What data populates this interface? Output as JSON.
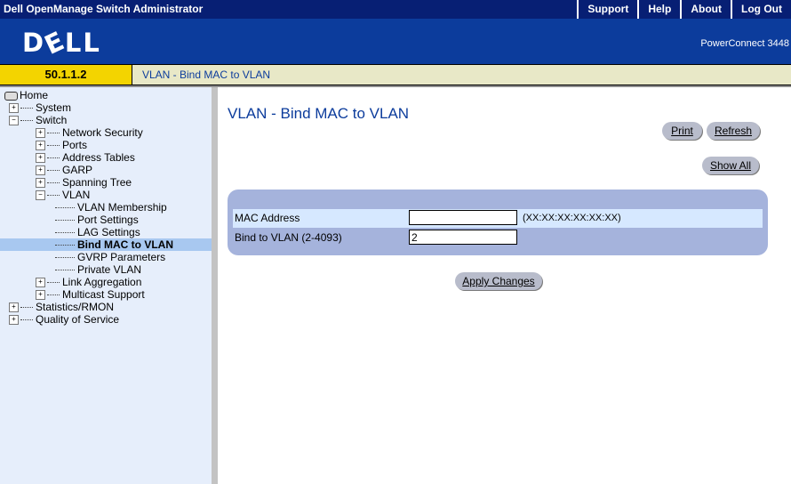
{
  "header": {
    "app_title": "Dell OpenManage Switch Administrator",
    "nav": [
      "Support",
      "Help",
      "About",
      "Log Out"
    ],
    "logo_text": "DELL",
    "product": "PowerConnect 3448"
  },
  "address": {
    "ip": "50.1.1.2",
    "breadcrumb": "VLAN - Bind MAC to VLAN"
  },
  "sidebar": {
    "items": [
      {
        "label": "Home",
        "icon": "home-icon"
      },
      {
        "label": "System",
        "toggle": "+"
      },
      {
        "label": "Switch",
        "toggle": "-"
      },
      {
        "label": "Network Security",
        "toggle": "+"
      },
      {
        "label": "Ports",
        "toggle": "+"
      },
      {
        "label": "Address Tables",
        "toggle": "+"
      },
      {
        "label": "GARP",
        "toggle": "+"
      },
      {
        "label": "Spanning Tree",
        "toggle": "+"
      },
      {
        "label": "VLAN",
        "toggle": "-"
      },
      {
        "label": "VLAN Membership"
      },
      {
        "label": "Port Settings"
      },
      {
        "label": "LAG Settings"
      },
      {
        "label": "Bind MAC to VLAN",
        "selected": true
      },
      {
        "label": "GVRP Parameters"
      },
      {
        "label": "Private VLAN"
      },
      {
        "label": "Link Aggregation",
        "toggle": "+"
      },
      {
        "label": "Multicast Support",
        "toggle": "+"
      },
      {
        "label": "Statistics/RMON",
        "toggle": "+"
      },
      {
        "label": "Quality of Service",
        "toggle": "+"
      }
    ]
  },
  "main": {
    "title": "VLAN - Bind MAC to VLAN",
    "print_label": "Print",
    "refresh_label": "Refresh",
    "show_all_label": "Show All",
    "form": {
      "mac_label": "MAC Address",
      "mac_value": "",
      "mac_hint": "(XX:XX:XX:XX:XX:XX)",
      "vlan_label": "Bind to VLAN (2-4093)",
      "vlan_value": "2"
    },
    "apply_label": "Apply Changes"
  },
  "colors": {
    "title_bar": "#071f74",
    "brand_band": "#0c3c9c",
    "ip_box": "#f3d400",
    "sidebar_bg": "#e6eefb",
    "panel": "#a5b3dc",
    "selected": "#a8c8f0"
  }
}
